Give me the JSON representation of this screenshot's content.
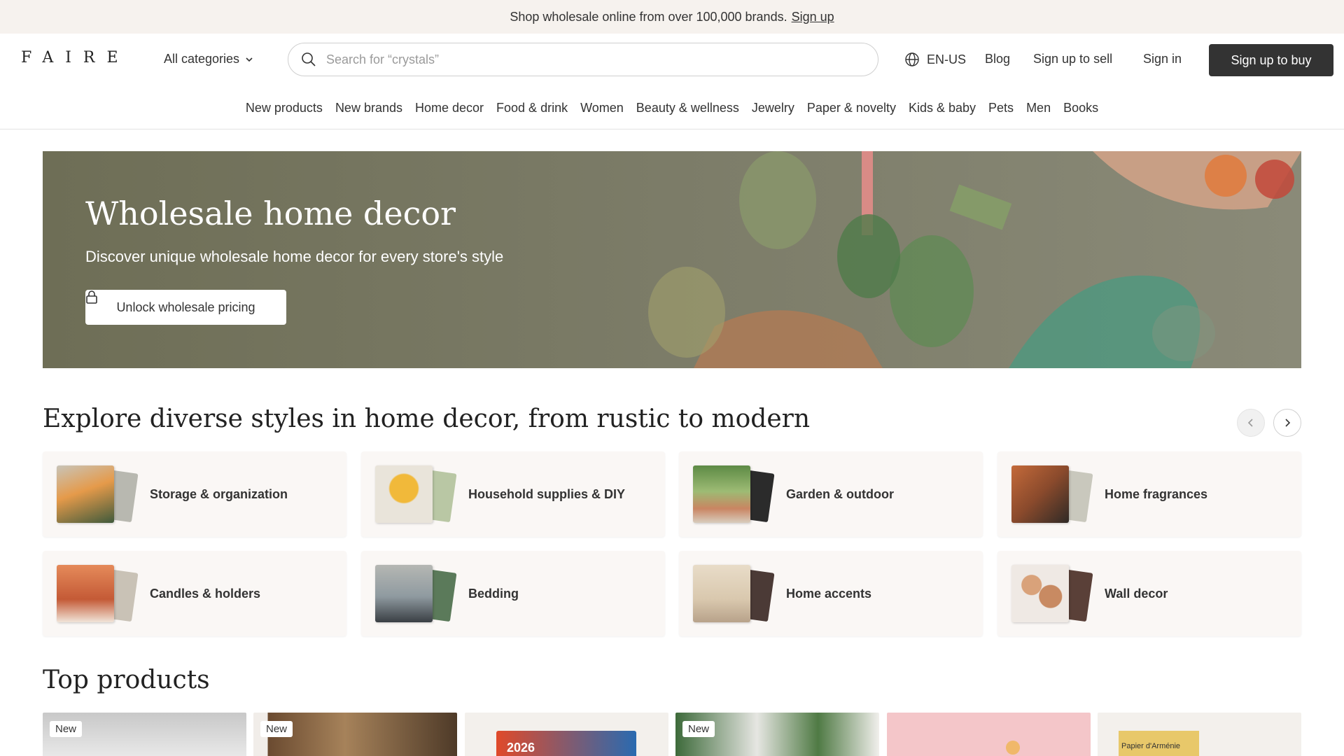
{
  "announcement": {
    "text": "Shop wholesale online from over 100,000 brands.",
    "link": "Sign up"
  },
  "header": {
    "logo": "FAIRE",
    "all_categories": "All categories",
    "search_placeholder": "Search for “crystals”",
    "language": "EN-US",
    "blog": "Blog",
    "sell": "Sign up to sell",
    "sign_in": "Sign in",
    "buy": "Sign up to buy"
  },
  "categories_nav": [
    "New products",
    "New brands",
    "Home decor",
    "Food & drink",
    "Women",
    "Beauty & wellness",
    "Jewelry",
    "Paper & novelty",
    "Kids & baby",
    "Pets",
    "Men",
    "Books"
  ],
  "hero": {
    "title": "Wholesale home decor",
    "subtitle": "Discover unique wholesale home decor for every store's style",
    "button": "Unlock wholesale pricing"
  },
  "explore": {
    "title": "Explore diverse styles in home decor, from rustic to modern",
    "cards": [
      {
        "label": "Storage & organization"
      },
      {
        "label": "Household supplies & DIY"
      },
      {
        "label": "Garden & outdoor"
      },
      {
        "label": "Home fragrances"
      },
      {
        "label": "Candles & holders"
      },
      {
        "label": "Bedding"
      },
      {
        "label": "Home accents"
      },
      {
        "label": "Wall decor"
      }
    ]
  },
  "top_products": {
    "title": "Top products",
    "badges": [
      "New",
      "New",
      "New"
    ],
    "product_texts": [
      "2026",
      "Papier d'Arménie"
    ]
  },
  "colors": {
    "dark_button": "#333333",
    "announce_bg": "#f6f2ee",
    "card_bg": "#faf7f5"
  }
}
